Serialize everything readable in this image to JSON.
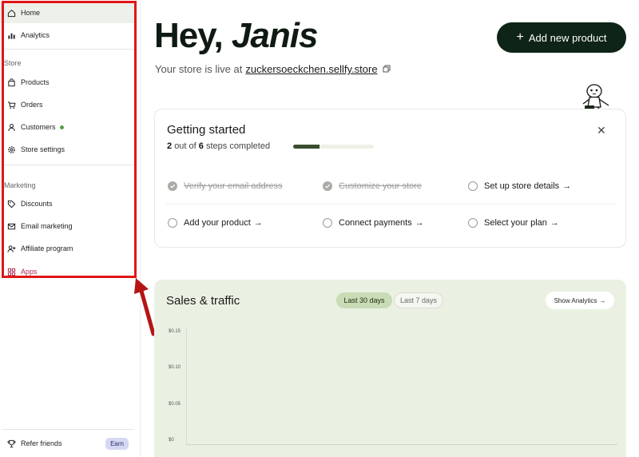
{
  "sidebar": {
    "nav_top": [
      {
        "label": "Home",
        "icon": "home-icon"
      },
      {
        "label": "Analytics",
        "icon": "bar-chart-icon"
      }
    ],
    "store_label": "Store",
    "store_items": [
      {
        "label": "Products",
        "icon": "bag-icon"
      },
      {
        "label": "Orders",
        "icon": "cart-icon"
      },
      {
        "label": "Customers",
        "icon": "user-icon"
      },
      {
        "label": "Store settings",
        "icon": "gear-icon"
      }
    ],
    "marketing_label": "Marketing",
    "marketing_items": [
      {
        "label": "Discounts",
        "icon": "tag-icon"
      },
      {
        "label": "Email marketing",
        "icon": "mail-icon"
      },
      {
        "label": "Affiliate program",
        "icon": "user-plus-icon"
      },
      {
        "label": "Apps",
        "icon": "apps-icon"
      }
    ],
    "refer_label": "Refer friends",
    "earn_badge": "Earn"
  },
  "header": {
    "greeting": "Hey,",
    "name": "Janis",
    "live_prefix": "Your store is live at",
    "store_url": "zuckersoeckchen.sellfy.store",
    "add_button": "Add new product"
  },
  "getting_started": {
    "title": "Getting started",
    "completed": "2",
    "out_of": "out of",
    "total": "6",
    "steps_completed": "steps completed",
    "progress": 0.33,
    "steps": [
      {
        "label": "Verify your email address",
        "done": true
      },
      {
        "label": "Customize your store",
        "done": true
      },
      {
        "label": "Set up store details",
        "done": false
      },
      {
        "label": "Add your product",
        "done": false
      },
      {
        "label": "Connect payments",
        "done": false
      },
      {
        "label": "Select your plan",
        "done": false
      }
    ]
  },
  "sales": {
    "title": "Sales & traffic",
    "tab_30": "Last 30 days",
    "tab_7": "Last 7 days",
    "show_analytics": "Show Analytics",
    "yticks": [
      "$0.15",
      "$0.10",
      "$0.05",
      "$0"
    ]
  },
  "colors": {
    "accent_dark": "#0e2417",
    "highlight_red": "#e01616",
    "apps_text": "#b02b52",
    "sales_bg": "#eaf1e3"
  }
}
